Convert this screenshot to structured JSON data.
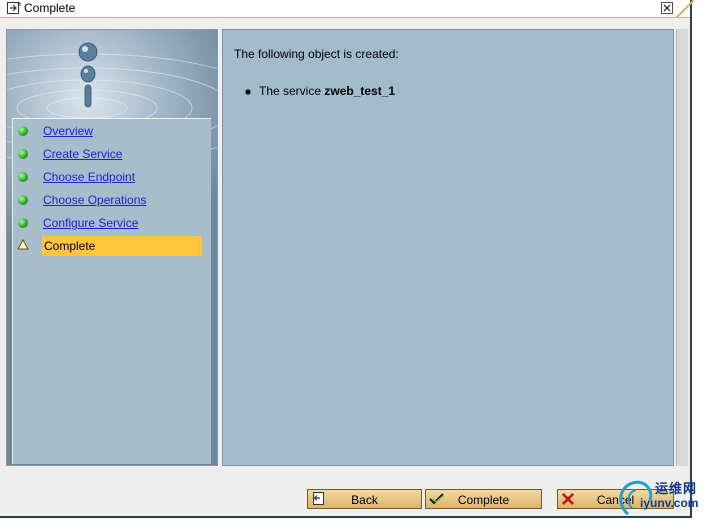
{
  "window": {
    "title": "Complete"
  },
  "nav": {
    "items": [
      {
        "label": "Overview",
        "status": "done"
      },
      {
        "label": "Create Service",
        "status": "done"
      },
      {
        "label": "Choose Endpoint",
        "status": "done"
      },
      {
        "label": "Choose Operations",
        "status": "done"
      },
      {
        "label": "Configure Service",
        "status": "done"
      },
      {
        "label": "Complete",
        "status": "current"
      }
    ]
  },
  "main": {
    "message": "The following object is created:",
    "bullet_prefix": "The service ",
    "service_name": "zweb_test_1"
  },
  "buttons": {
    "back": "Back",
    "complete": "Complete",
    "cancel": "Cancel"
  },
  "watermark": {
    "line1": "运维网",
    "line2": "iyunv.com"
  },
  "colors": {
    "highlight": "#ffc53d",
    "link": "#1d24cc",
    "content_bg": "#a3bccd",
    "button_bg": "#dcb46a",
    "status_done": "#2fae2b"
  },
  "icons": {
    "title": "wizard-window-icon",
    "close": "close-icon",
    "done": "green-light-icon",
    "current": "warning-triangle-icon",
    "back": "back-page-icon",
    "complete": "checkmark-icon",
    "cancel": "cancel-x-icon"
  }
}
